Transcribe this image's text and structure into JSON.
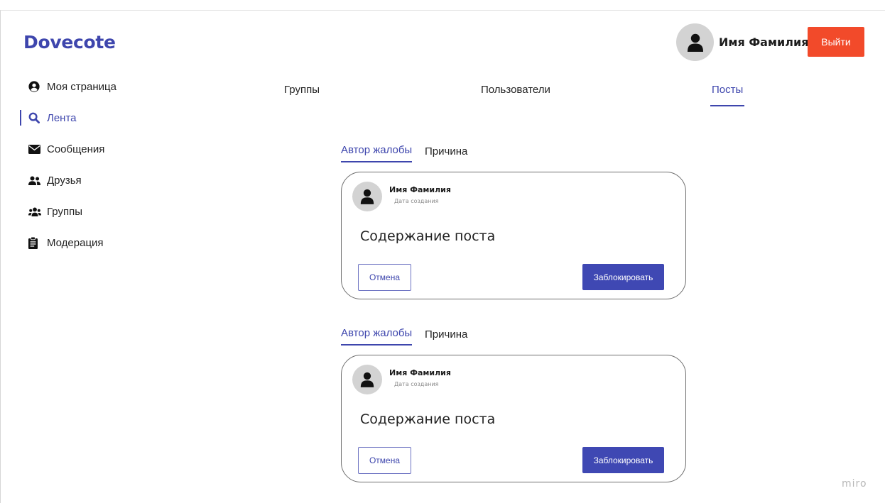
{
  "app": {
    "logo": "Dovecote",
    "watermark": "miro"
  },
  "header": {
    "user_name": "Имя Фамилия",
    "logout_label": "Выйти",
    "avatar_icon": "user-icon"
  },
  "colors": {
    "accent": "#3e46ad",
    "logout": "#f24a2a",
    "block_button": "#3f48b3",
    "avatar_bg": "#d3d3d3"
  },
  "sidebar": {
    "items": [
      {
        "label": "Моя страница",
        "icon": "user-circle-icon"
      },
      {
        "label": "Лента",
        "icon": "search-icon",
        "active": true
      },
      {
        "label": "Сообщения",
        "icon": "envelope-icon"
      },
      {
        "label": "Друзья",
        "icon": "user-friends-icon"
      },
      {
        "label": "Группы",
        "icon": "users-icon"
      },
      {
        "label": "Модерация",
        "icon": "clipboard-icon"
      }
    ]
  },
  "tabs": [
    {
      "label": "Группы"
    },
    {
      "label": "Пользователи"
    },
    {
      "label": "Посты",
      "active": true
    }
  ],
  "reports": [
    {
      "tabs": {
        "author": "Автор жалобы",
        "reason": "Причина",
        "active": "author"
      },
      "post": {
        "author": "Имя Фамилия",
        "date": "Дата создания",
        "content": "Содержание поста",
        "cancel_label": "Отмена",
        "block_label": "Заблокировать"
      }
    },
    {
      "tabs": {
        "author": "Автор жалобы",
        "reason": "Причина",
        "active": "author"
      },
      "post": {
        "author": "Имя Фамилия",
        "date": "Дата создания",
        "content": "Содержание поста",
        "cancel_label": "Отмена",
        "block_label": "Заблокировать"
      }
    }
  ]
}
